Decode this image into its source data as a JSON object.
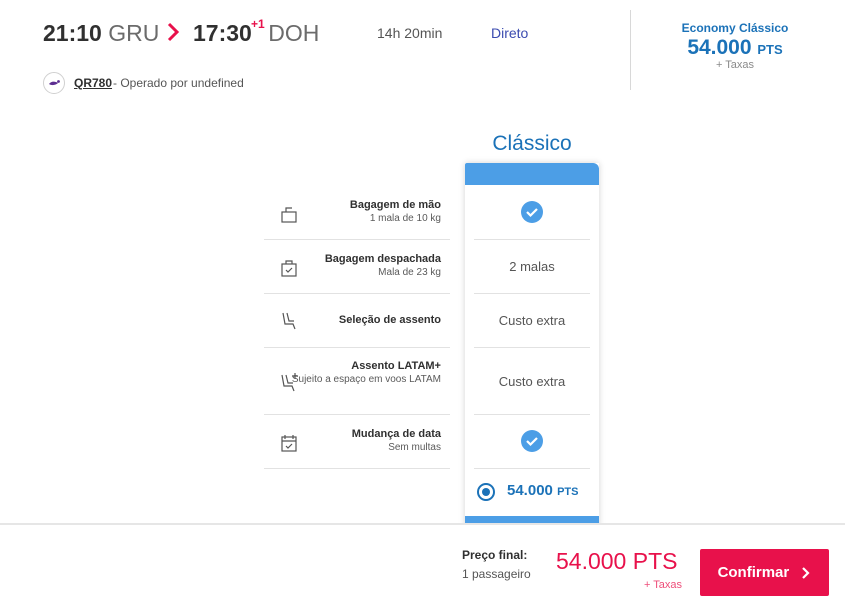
{
  "flight": {
    "departure_time": "21:10",
    "departure_airport": "GRU",
    "arrival_time": "17:30",
    "arrival_day_offset": "+1",
    "arrival_airport": "DOH",
    "duration": "14h 20min",
    "stops": "Direto",
    "flight_number": "QR780",
    "operated_by": "- Operado por undefined"
  },
  "fare_summary": {
    "cabin": "Economy Clássico",
    "points": "54.000",
    "points_unit": "PTS",
    "taxes": "+ Taxas"
  },
  "brand": {
    "title": "Clássico",
    "selected_points": "54.000",
    "selected_unit": "PTS"
  },
  "features": [
    {
      "icon": "carry-on-bag-icon",
      "name": "Bagagem de mão",
      "sub": "1 mala de 10 kg",
      "value": "",
      "included": true
    },
    {
      "icon": "checked-bag-icon",
      "name": "Bagagem despachada",
      "sub": "Mala de 23 kg",
      "value": "2 malas",
      "included": false
    },
    {
      "icon": "seat-icon",
      "name": "Seleção de assento",
      "sub": "",
      "value": "Custo extra",
      "included": false
    },
    {
      "icon": "seat-plus-icon",
      "name": "Assento LATAM+",
      "sub": "Sujeito a espaço em voos LATAM",
      "value": "Custo extra",
      "included": false
    },
    {
      "icon": "calendar-icon",
      "name": "Mudança de data",
      "sub": "Sem multas",
      "value": "",
      "included": true
    }
  ],
  "footer": {
    "label": "Preço final:",
    "passengers": "1 passageiro",
    "total": "54.000 PTS",
    "taxes": "+ Taxas",
    "confirm_label": "Confirmar"
  },
  "colors": {
    "accent_blue": "#1b72b8",
    "card_blue": "#4c9ee6",
    "brand_red": "#e8114b"
  }
}
